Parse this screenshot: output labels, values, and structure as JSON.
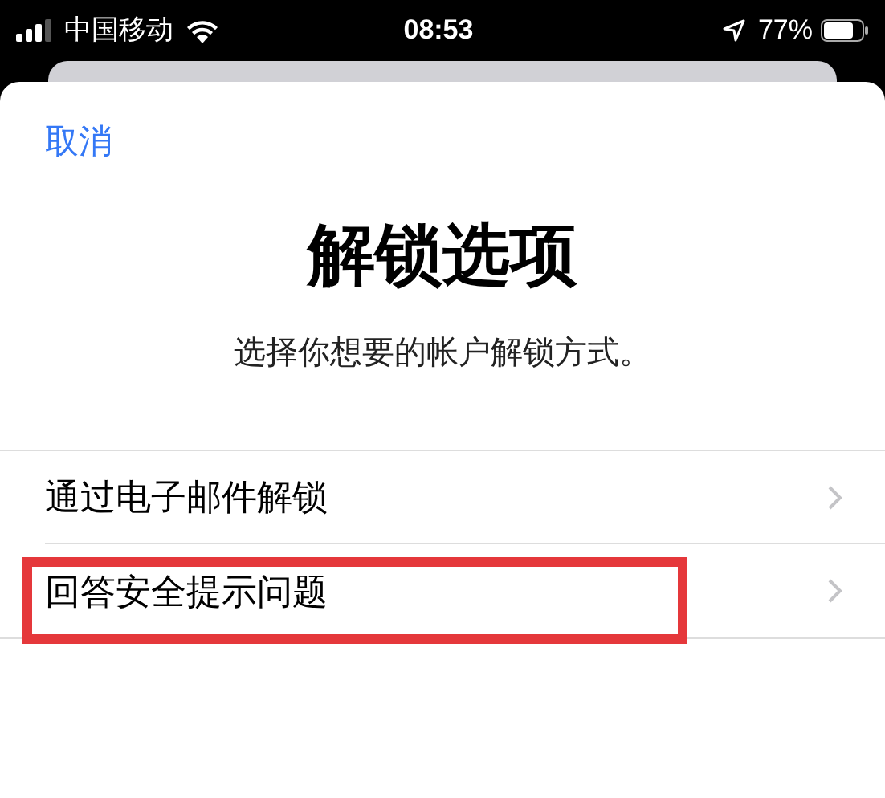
{
  "status_bar": {
    "carrier": "中国移动",
    "time": "08:53",
    "battery": "77%"
  },
  "sheet": {
    "cancel": "取消",
    "title": "解锁选项",
    "subtitle": "选择你想要的帐户解锁方式。",
    "options": [
      {
        "label": "通过电子邮件解锁",
        "highlighted": false
      },
      {
        "label": "回答安全提示问题",
        "highlighted": true
      }
    ]
  }
}
